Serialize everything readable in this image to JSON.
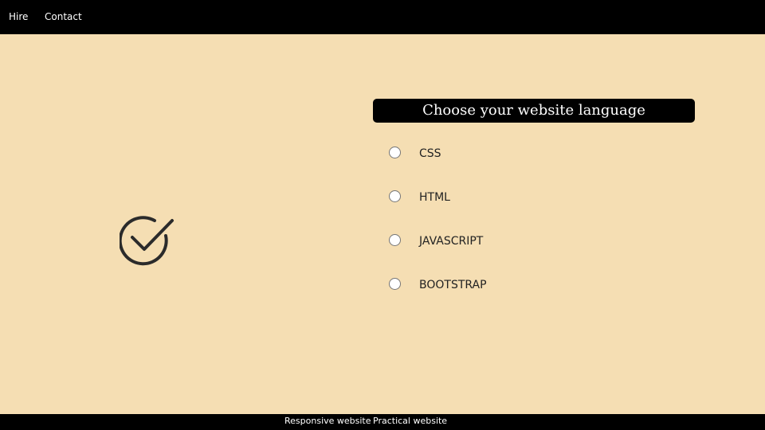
{
  "nav": {
    "items": [
      {
        "label": "Hire"
      },
      {
        "label": "Contact"
      }
    ]
  },
  "graphic": {
    "icon": "check-circle-icon",
    "color": "#2b2b2b"
  },
  "form": {
    "title": "Choose your website language",
    "options": [
      {
        "label": "CSS",
        "checked": false
      },
      {
        "label": "HTML",
        "checked": false
      },
      {
        "label": "JAVASCRIPT",
        "checked": false
      },
      {
        "label": "BOOTSTRAP",
        "checked": false
      }
    ]
  },
  "footer": {
    "links": [
      {
        "label": "Responsive website"
      },
      {
        "label": "Practical website"
      }
    ]
  },
  "colors": {
    "background": "#f5deb3",
    "bars": "#000000"
  }
}
